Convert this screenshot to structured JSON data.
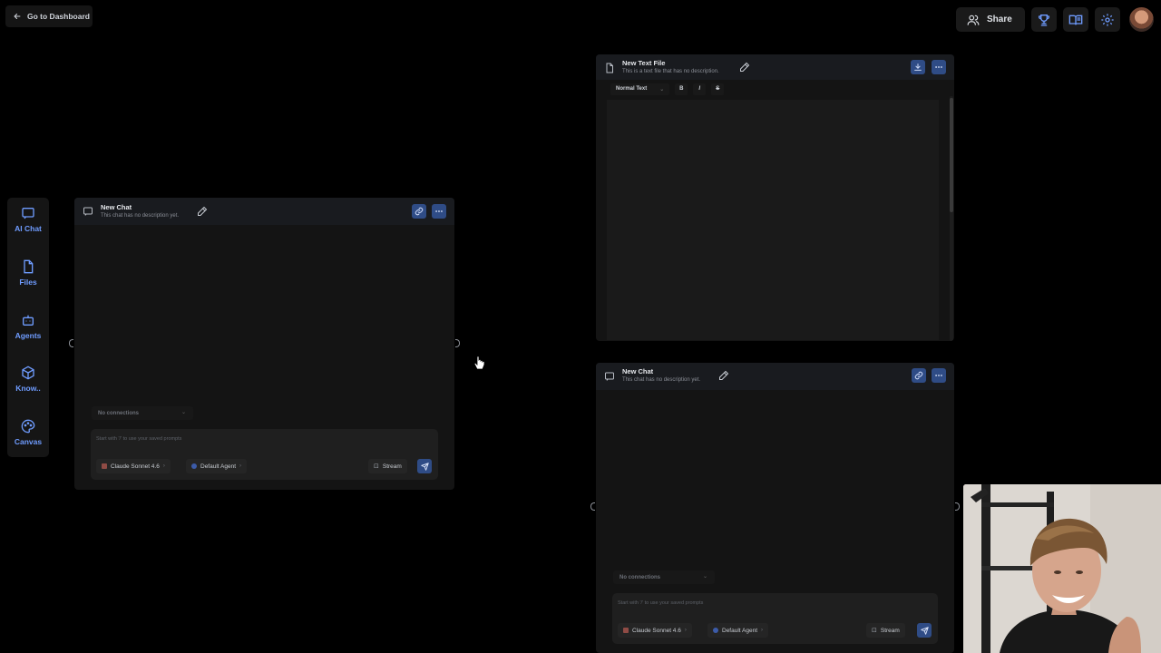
{
  "top_bar": {
    "dashboard_label": "Go to Dashboard",
    "share_label": "Share",
    "icons": [
      "trophy-icon",
      "book-open-icon",
      "gear-icon"
    ]
  },
  "sidebar": {
    "items": [
      {
        "label": "AI Chat",
        "icon": "message-square-icon"
      },
      {
        "label": "Files",
        "icon": "file-icon"
      },
      {
        "label": "Agents",
        "icon": "bot-icon"
      },
      {
        "label": "Know..",
        "icon": "box-icon"
      },
      {
        "label": "Canvas",
        "icon": "palette-icon"
      }
    ]
  },
  "chat_left": {
    "title": "New Chat",
    "description": "This chat has no description yet.",
    "connections": "No connections",
    "placeholder": "Start with '/' to use your saved prompts",
    "model": "Claude Sonnet 4.6",
    "agent": "Default Agent",
    "stream": "Stream"
  },
  "text_file": {
    "title": "New Text File",
    "description": "This is a text file that has no description.",
    "format": "Normal Text",
    "bold": "B",
    "italic": "I",
    "strike": "S"
  },
  "chat_right": {
    "title": "New Chat",
    "description": "This chat has no description yet.",
    "connections": "No connections",
    "placeholder": "Start with '/' to use your saved prompts",
    "model": "Claude Sonnet 4.6",
    "agent": "Default Agent",
    "stream": "Stream"
  },
  "colors": {
    "accent": "#6f9cff",
    "button_blue": "#2f4c86",
    "panel": "#141414",
    "background": "#000000"
  }
}
